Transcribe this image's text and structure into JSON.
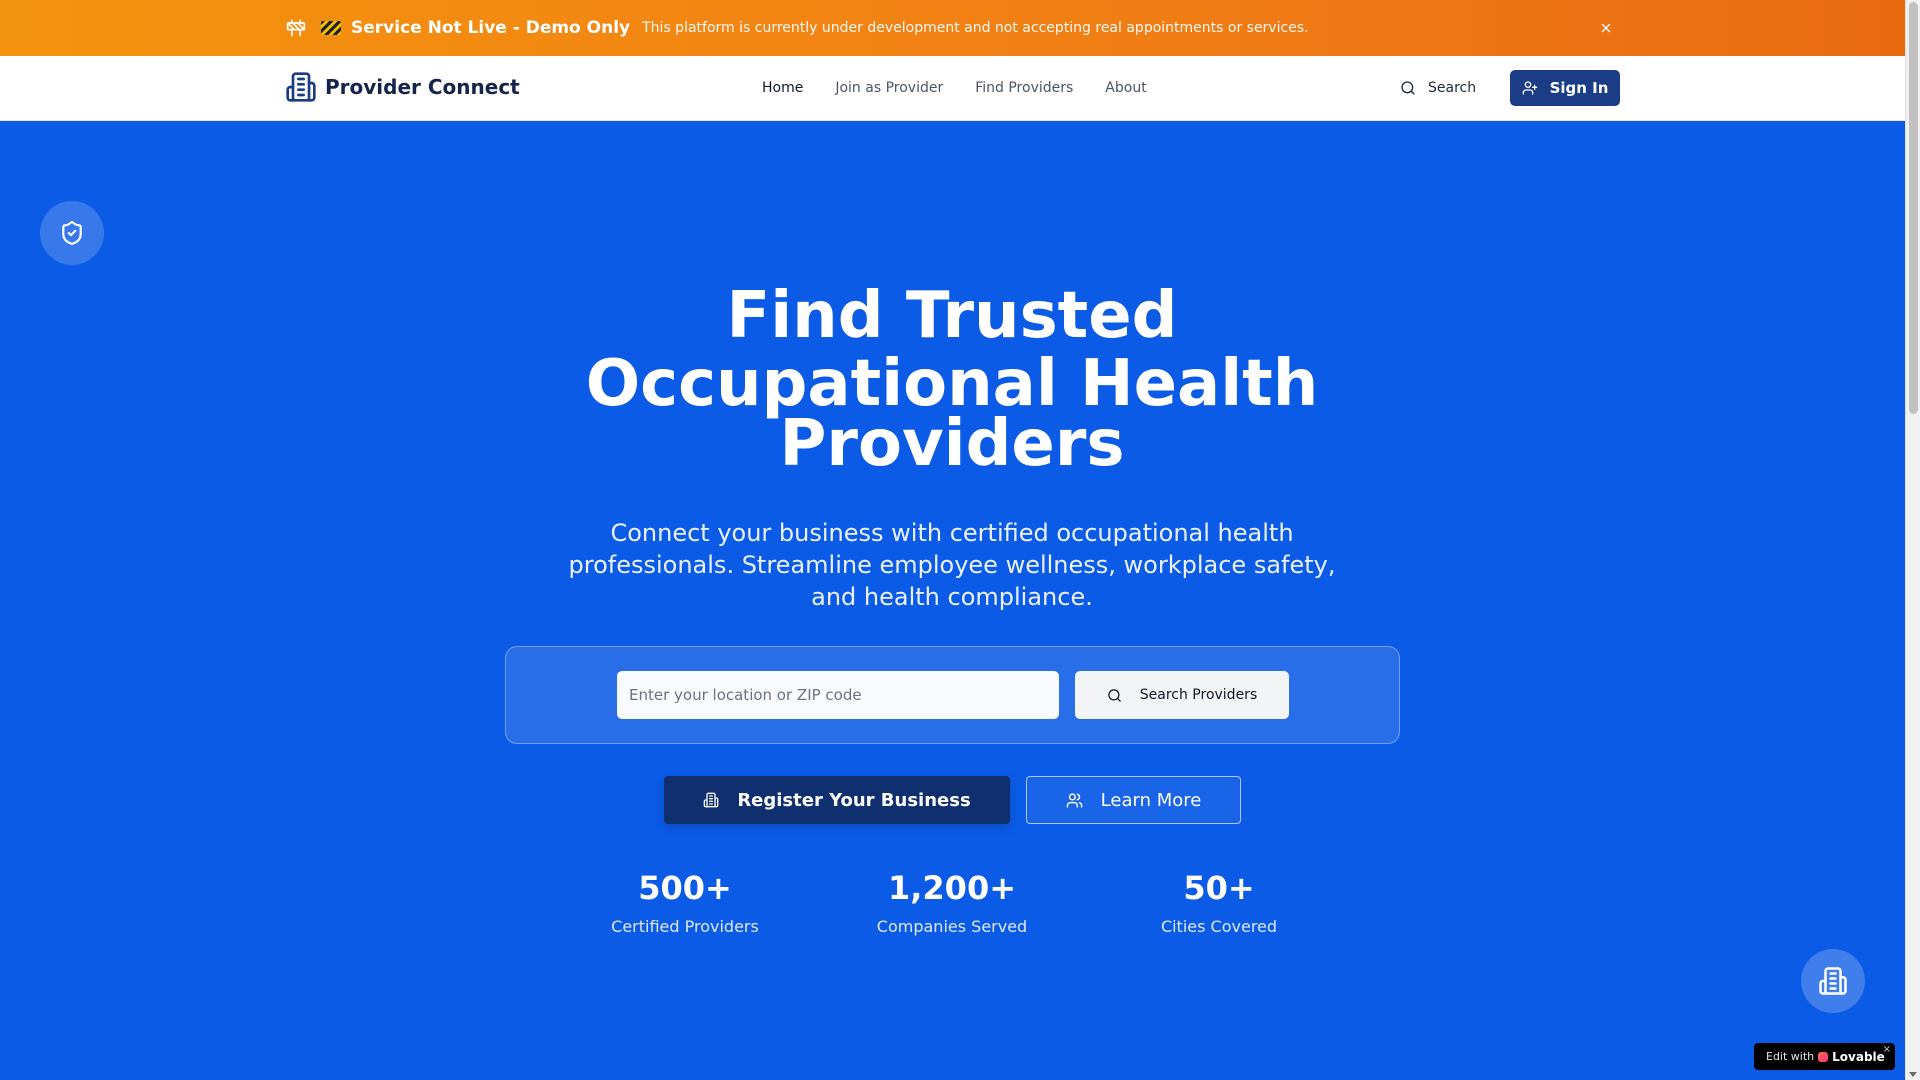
{
  "colors": {
    "banner_start": "#f5940f",
    "banner_end": "#ea6a12",
    "hero_bg": "#0b5be6",
    "brand_dark": "#1b3c86",
    "register_bg": "#102f6e"
  },
  "banner": {
    "title": "Service Not Live - Demo Only",
    "message": "This platform is currently under development and not accepting real appointments or services.",
    "icons": [
      "construction-sign-icon",
      "caution-tape-icon",
      "close-icon"
    ]
  },
  "navbar": {
    "brand": "Provider Connect",
    "brand_icon": "building-icon",
    "links": [
      {
        "label": "Home",
        "active": true
      },
      {
        "label": "Join as Provider",
        "active": false
      },
      {
        "label": "Find Providers",
        "active": false
      },
      {
        "label": "About",
        "active": false
      }
    ],
    "search_label": "Search",
    "signin_label": "Sign In"
  },
  "hero": {
    "title_line1": "Find Trusted",
    "title_line2": "Occupational Health",
    "title_line3": "Providers",
    "subtitle": "Connect your business with certified occupational health professionals. Streamline employee wellness, workplace safety, and health compliance.",
    "search": {
      "placeholder": "Enter your location or ZIP code",
      "value": "",
      "button_label": "Search Providers"
    },
    "register_label": "Register Your Business",
    "learn_more_label": "Learn More"
  },
  "stats": [
    {
      "value": "500+",
      "label": "Certified Providers"
    },
    {
      "value": "1,200+",
      "label": "Companies Served"
    },
    {
      "value": "50+",
      "label": "Cities Covered"
    }
  ],
  "lovable_badge": {
    "edit_text": "Edit with",
    "brand": "Lovable"
  }
}
